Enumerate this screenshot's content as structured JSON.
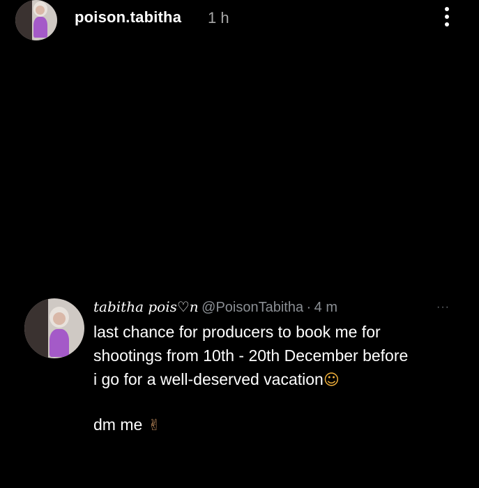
{
  "story": {
    "username": "poison.tabitha",
    "time": "1 h",
    "more_icon": "more-vertical-icon"
  },
  "tweet": {
    "display_name": "tabitha pois♡n",
    "handle": "@PoisonTabitha",
    "separator": "·",
    "time": "4 m",
    "more_label": "···",
    "body_lines": [
      "last chance for producers to book me for",
      "shootings from 10th - 20th December before",
      "i go for a well-deserved vacation"
    ],
    "emoji_smile": "☺",
    "dm_text": "dm me",
    "emoji_peace": "✌"
  }
}
